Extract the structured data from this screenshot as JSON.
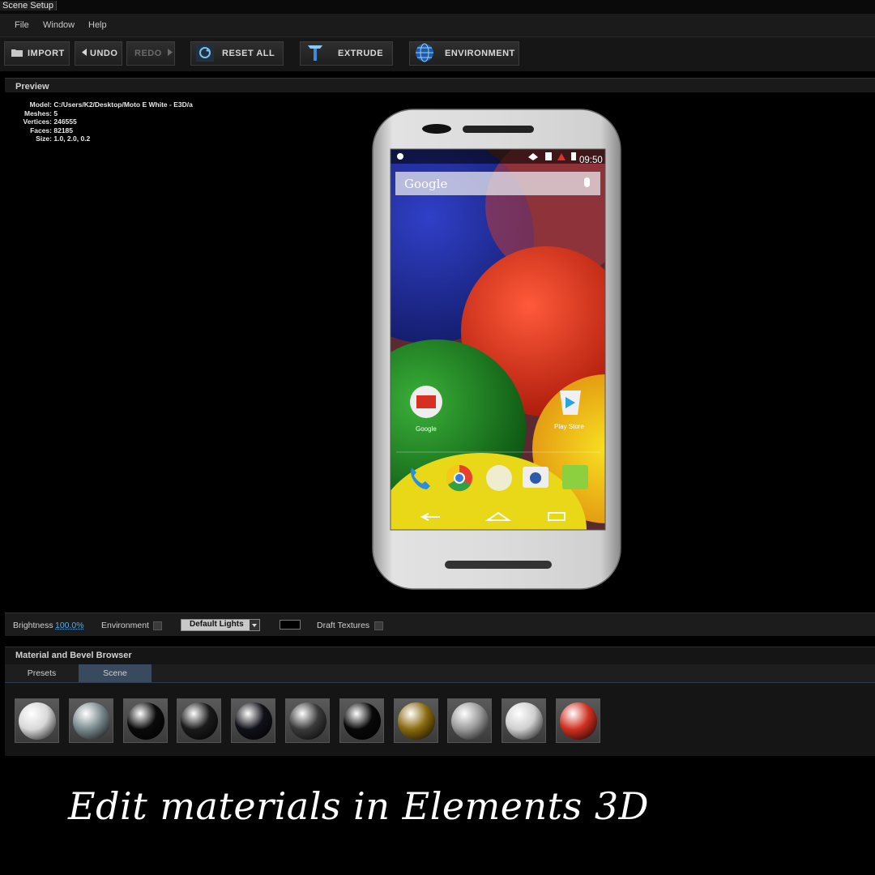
{
  "window": {
    "title": "Scene Setup"
  },
  "menu": {
    "file": "File",
    "window": "Window",
    "help": "Help"
  },
  "toolbar": {
    "import": "IMPORT",
    "undo": "UNDO",
    "redo": "REDO",
    "reset_all": "RESET ALL",
    "extrude": "EXTRUDE",
    "environment": "ENVIRONMENT"
  },
  "preview": {
    "title": "Preview",
    "info": {
      "model_label": "Model:",
      "model_value": "C:/Users/K2/Desktop/Moto E White  - E3D/a",
      "meshes_label": "Meshes:",
      "meshes_value": "5",
      "vertices_label": "Vertices:",
      "vertices_value": "246555",
      "faces_label": "Faces:",
      "faces_value": "82185",
      "size_label": "Size:",
      "size_value": "1.0, 2.0, 0.2"
    },
    "phone_screen": {
      "time": "09:50",
      "search_brand": "Google",
      "app_google": "Google",
      "app_playstore": "Play Store"
    }
  },
  "statusbar": {
    "brightness_label": "Brightness",
    "brightness_value": "100.0%",
    "environment_label": "Environment",
    "lights_select": "Default Lights",
    "draft_label": "Draft Textures"
  },
  "material_browser": {
    "title": "Material and Bevel Browser",
    "tabs": [
      "Presets",
      "Scene"
    ],
    "active_tab": "Scene",
    "swatches": [
      {
        "icon": "white-matte-sphere",
        "color": "#d8d8d8"
      },
      {
        "icon": "chrome-sphere",
        "color": "#7a8a8e"
      },
      {
        "icon": "gloss-black-sphere",
        "color": "#0a0a0a"
      },
      {
        "icon": "textured-black-sphere",
        "color": "#1a1a1a"
      },
      {
        "icon": "black-blue-rim-sphere",
        "color": "#101018"
      },
      {
        "icon": "dark-gray-sphere",
        "color": "#3a3a3a"
      },
      {
        "icon": "black-sphere",
        "color": "#080808"
      },
      {
        "icon": "gold-sphere",
        "color": "#8a6a10"
      },
      {
        "icon": "light-gray-sphere",
        "color": "#9a9a9a"
      },
      {
        "icon": "silver-sphere",
        "color": "#cfcfcf"
      },
      {
        "icon": "red-green-sphere",
        "color": "#d03020"
      }
    ]
  },
  "caption": "Edit materials in Elements 3D"
}
